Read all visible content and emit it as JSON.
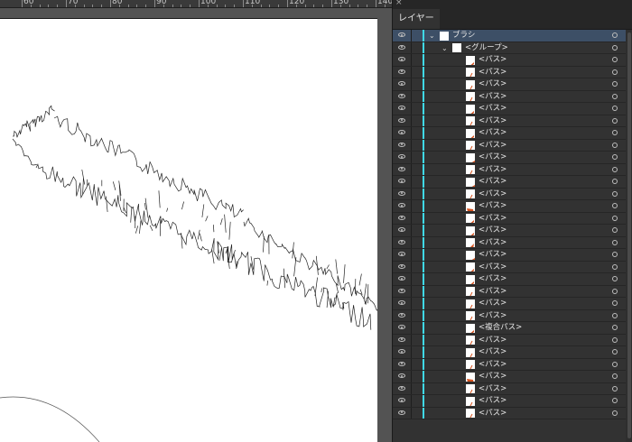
{
  "ruler": {
    "labels": [
      "60",
      "70",
      "80",
      "90",
      "100",
      "110",
      "120",
      "130",
      "140"
    ]
  },
  "panel": {
    "tab_label": "レイヤー",
    "layer_name": "ブラシ",
    "group_name": "<グループ>",
    "rows": [
      {
        "label": "<パス>",
        "thumb": "slash"
      },
      {
        "label": "<パス>",
        "thumb": "thin"
      },
      {
        "label": "<パス>",
        "thumb": "thin"
      },
      {
        "label": "<パス>",
        "thumb": "thin"
      },
      {
        "label": "<パス>",
        "thumb": "slash"
      },
      {
        "label": "<パス>",
        "thumb": "thin"
      },
      {
        "label": "<パス>",
        "thumb": "slash"
      },
      {
        "label": "<パス>",
        "thumb": "thin"
      },
      {
        "label": "<パス>",
        "thumb": "wide"
      },
      {
        "label": "<パス>",
        "thumb": "thin"
      },
      {
        "label": "<パス>",
        "thumb": "wide"
      },
      {
        "label": "<パス>",
        "thumb": "thin"
      },
      {
        "label": "<パス>",
        "thumb": "blob"
      },
      {
        "label": "<パス>",
        "thumb": "slash"
      },
      {
        "label": "<パス>",
        "thumb": "slash"
      },
      {
        "label": "<パス>",
        "thumb": "wedge"
      },
      {
        "label": "<パス>",
        "thumb": "wide"
      },
      {
        "label": "<パス>",
        "thumb": "slash"
      },
      {
        "label": "<パス>",
        "thumb": "slash"
      },
      {
        "label": "<パス>",
        "thumb": "thin"
      },
      {
        "label": "<パス>",
        "thumb": "thin"
      },
      {
        "label": "<パス>",
        "thumb": "thin"
      },
      {
        "label": "<複合パス>",
        "thumb": "slash"
      },
      {
        "label": "<パス>",
        "thumb": "thin"
      },
      {
        "label": "<パス>",
        "thumb": "thin"
      },
      {
        "label": "<パス>",
        "thumb": "thin"
      },
      {
        "label": "<パス>",
        "thumb": "blob"
      },
      {
        "label": "<パス>",
        "thumb": "thin"
      },
      {
        "label": "<パス>",
        "thumb": "thin"
      },
      {
        "label": "<パス>",
        "thumb": "thin"
      }
    ]
  },
  "colors": {
    "layer_color": "#3fd8e6",
    "path_fill": "#d9531e",
    "selected_row": "#3d4f66"
  }
}
